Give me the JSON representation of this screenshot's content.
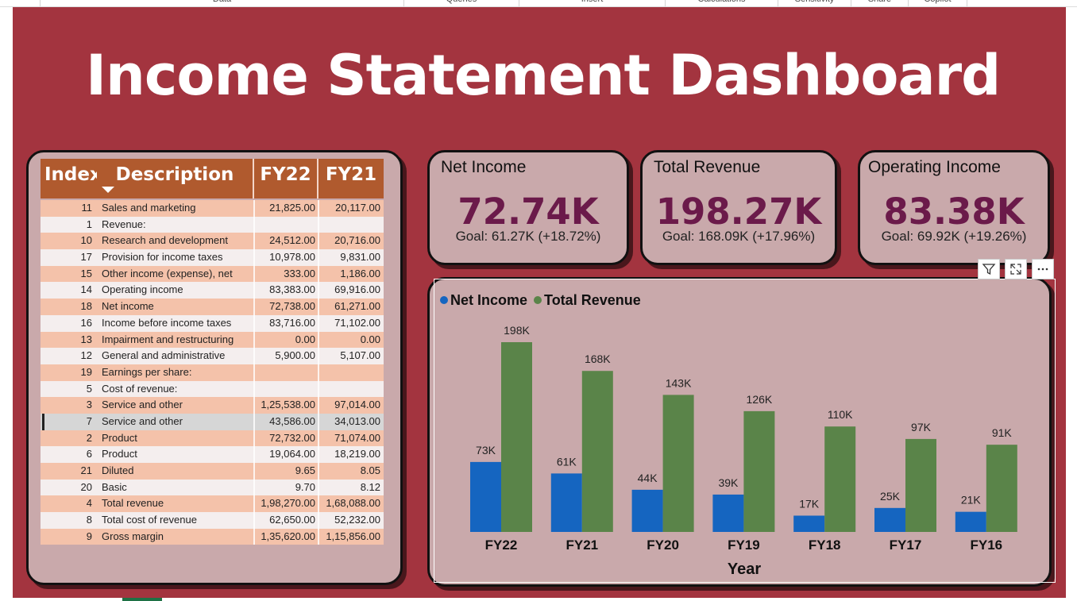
{
  "ribbon": {
    "groups": [
      "Data",
      "Queries",
      "Insert",
      "Calculations",
      "Sensitivity",
      "Share",
      "Copilot"
    ]
  },
  "dashboard": {
    "title": "Income Statement Dashboard"
  },
  "table": {
    "headers": {
      "index": "Index",
      "description": "Description",
      "fy22": "FY22",
      "fy21": "FY21"
    },
    "rows": [
      {
        "index": "11",
        "description": "Sales and marketing",
        "fy22": "21,825.00",
        "fy21": "20,117.00"
      },
      {
        "index": "1",
        "description": "Revenue:",
        "fy22": "",
        "fy21": ""
      },
      {
        "index": "10",
        "description": "Research and development",
        "fy22": "24,512.00",
        "fy21": "20,716.00"
      },
      {
        "index": "17",
        "description": "Provision for income taxes",
        "fy22": "10,978.00",
        "fy21": "9,831.00"
      },
      {
        "index": "15",
        "description": "Other income (expense), net",
        "fy22": "333.00",
        "fy21": "1,186.00"
      },
      {
        "index": "14",
        "description": "Operating income",
        "fy22": "83,383.00",
        "fy21": "69,916.00"
      },
      {
        "index": "18",
        "description": "Net income",
        "fy22": "72,738.00",
        "fy21": "61,271.00"
      },
      {
        "index": "16",
        "description": "Income before income taxes",
        "fy22": "83,716.00",
        "fy21": "71,102.00"
      },
      {
        "index": "13",
        "description": "Impairment and restructuring",
        "fy22": "0.00",
        "fy21": "0.00"
      },
      {
        "index": "12",
        "description": "General and administrative",
        "fy22": "5,900.00",
        "fy21": "5,107.00"
      },
      {
        "index": "19",
        "description": "Earnings per share:",
        "fy22": "",
        "fy21": ""
      },
      {
        "index": "5",
        "description": "Cost of revenue:",
        "fy22": "",
        "fy21": ""
      },
      {
        "index": "3",
        "description": "Service and other",
        "fy22": "1,25,538.00",
        "fy21": "97,014.00"
      },
      {
        "index": "7",
        "description": "Service and other",
        "fy22": "43,586.00",
        "fy21": "34,013.00"
      },
      {
        "index": "2",
        "description": "Product",
        "fy22": "72,732.00",
        "fy21": "71,074.00"
      },
      {
        "index": "6",
        "description": "Product",
        "fy22": "19,064.00",
        "fy21": "18,219.00"
      },
      {
        "index": "21",
        "description": "Diluted",
        "fy22": "9.65",
        "fy21": "8.05"
      },
      {
        "index": "20",
        "description": "Basic",
        "fy22": "9.70",
        "fy21": "8.12"
      },
      {
        "index": "4",
        "description": "Total revenue",
        "fy22": "1,98,270.00",
        "fy21": "1,68,088.00"
      },
      {
        "index": "8",
        "description": "Total cost of revenue",
        "fy22": "62,650.00",
        "fy21": "52,232.00"
      },
      {
        "index": "9",
        "description": "Gross margin",
        "fy22": "1,35,620.00",
        "fy21": "1,15,856.00"
      }
    ],
    "selected_row": 13
  },
  "kpis": {
    "net_income": {
      "title": "Net Income",
      "value": "72.74K",
      "goal": "Goal: 61.27K (+18.72%)"
    },
    "total_revenue": {
      "title": "Total Revenue",
      "value": "198.27K",
      "goal": "Goal: 168.09K (+17.96%)"
    },
    "operating_income": {
      "title": "Operating Income",
      "value": "83.38K",
      "goal": "Goal: 69.92K (+19.26%)"
    }
  },
  "colors": {
    "canvas": "#a3343f",
    "panel": "#c9a9ab",
    "kpi_value": "#6b1a4a",
    "net_income": "#1565c0",
    "total_revenue": "#5a8449"
  },
  "visual_toolbar": {
    "icons": [
      "filter-icon",
      "focus-mode-icon",
      "more-options-icon"
    ]
  },
  "chart_data": {
    "type": "bar",
    "categories": [
      "FY22",
      "FY21",
      "FY20",
      "FY19",
      "FY18",
      "FY17",
      "FY16"
    ],
    "series": [
      {
        "name": "Net Income",
        "values": [
          73,
          61,
          44,
          39,
          17,
          25,
          21
        ],
        "labels": [
          "73K",
          "61K",
          "44K",
          "39K",
          "17K",
          "25K",
          "21K"
        ],
        "color": "#1565c0"
      },
      {
        "name": "Total Revenue",
        "values": [
          198,
          168,
          143,
          126,
          110,
          97,
          91
        ],
        "labels": [
          "198K",
          "168K",
          "143K",
          "126K",
          "110K",
          "97K",
          "91K"
        ],
        "color": "#5a8449"
      }
    ],
    "unit": "K",
    "xlabel": "Year",
    "ylabel": "",
    "ylim": [
      0,
      198
    ],
    "legend": "top-left",
    "grid": false
  }
}
